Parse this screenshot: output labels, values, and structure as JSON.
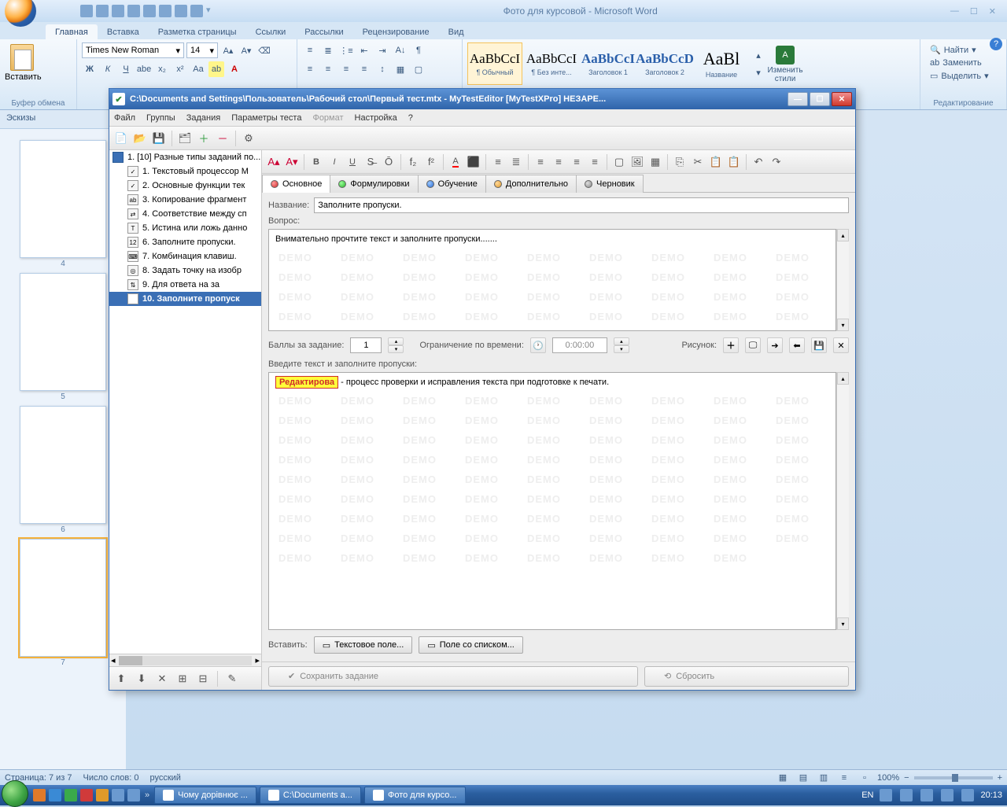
{
  "word": {
    "title": "Фото для курсовой - Microsoft Word",
    "qat_icons": [
      "save",
      "undo",
      "redo",
      "print",
      "preview",
      "new",
      "open",
      "spell"
    ],
    "tabs": [
      "Главная",
      "Вставка",
      "Разметка страницы",
      "Ссылки",
      "Рассылки",
      "Рецензирование",
      "Вид"
    ],
    "active_tab": 0,
    "groups": {
      "clipboard": "Буфер обмена",
      "editing": "Редактирование",
      "paste": "Вставить"
    },
    "font_name": "Times New Roman",
    "font_size": "14",
    "styles": [
      {
        "sample": "AaBbCcI",
        "name": "¶ Обычный",
        "color": "#000"
      },
      {
        "sample": "AaBbCcI",
        "name": "¶ Без инте...",
        "color": "#000"
      },
      {
        "sample": "AaBbCcI",
        "name": "Заголовок 1",
        "color": "#2a5faa",
        "bold": true
      },
      {
        "sample": "AaBbCcD",
        "name": "Заголовок 2",
        "color": "#2a5faa",
        "bold": true
      },
      {
        "sample": "AaBl",
        "name": "Название",
        "color": "#000",
        "big": true
      }
    ],
    "change_styles": "Изменить стили",
    "editing_items": [
      "Найти",
      "Заменить",
      "Выделить"
    ],
    "thumb_header": "Эскизы",
    "thumbs": [
      "4",
      "5",
      "6",
      "7"
    ],
    "thumb_selected": 3,
    "status": {
      "page": "Страница: 7 из 7",
      "words": "Число слов: 0",
      "lang": "русский",
      "zoom": "100%"
    }
  },
  "mte": {
    "title": "C:\\Documents and Settings\\Пользователь\\Рабочий стол\\Первый тест.mtx - MyTestEditor [MyTestXPro] НЕЗАРЕ...",
    "menu": [
      "Файл",
      "Группы",
      "Задания",
      "Параметры теста",
      "Формат",
      "Настройка",
      "?"
    ],
    "menu_disabled": [
      4
    ],
    "tree_root": "1. [10] Разные типы заданий по...",
    "tree_items": [
      "1. Текстовый процессор M",
      "2. Основные функции тек",
      "3. Копирование фрагмент",
      "4. Соответствие между сп",
      "5. Истина или ложь данно",
      "6. Заполните пропуски.",
      "7. Комбинация клавиш.",
      "8. Задать точку на изобр",
      "9. Для ответа на за",
      "10. Заполните пропуск"
    ],
    "tree_selected": 9,
    "tabs": [
      {
        "label": "Основное",
        "dot": "red"
      },
      {
        "label": "Формулировки",
        "dot": "green"
      },
      {
        "label": "Обучение",
        "dot": "blue"
      },
      {
        "label": "Дополнительно",
        "dot": "orange"
      },
      {
        "label": "Черновик",
        "dot": "gray"
      }
    ],
    "active_tab": 0,
    "name_label": "Название:",
    "name_value": "Заполните пропуски.",
    "question_label": "Вопрос:",
    "question_text": "Внимательно прочтите текст и заполните пропуски.......",
    "points_label": "Баллы за задание:",
    "points_value": "1",
    "time_label": "Ограничение по времени:",
    "time_value": "0:00:00",
    "picture_label": "Рисунок:",
    "fill_label": "Введите текст и заполните пропуски:",
    "fill_highlight": "Редактирова",
    "fill_rest": " - процесс проверки и исправления текста при подготовке к печати.",
    "insert_label": "Вставить:",
    "insert_text_field": "Текстовое поле...",
    "insert_combo": "Поле со списком...",
    "save_btn": "Сохранить задание",
    "reset_btn": "Сбросить",
    "watermark": "DEMO"
  },
  "taskbar": {
    "items": [
      "Чому дорівнює ...",
      "C:\\Documents a...",
      "Фото для курсо..."
    ],
    "lang": "EN",
    "time": "20:13"
  }
}
